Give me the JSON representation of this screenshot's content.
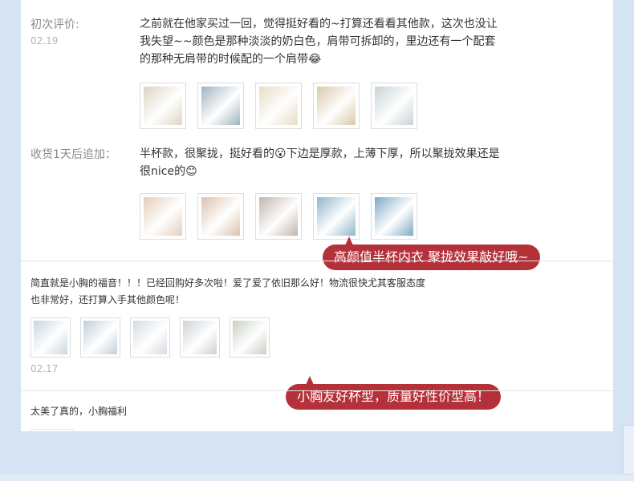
{
  "review1": {
    "label": "初次评价:",
    "date": "02.19",
    "lines": [
      "之前就在他家买过一回，觉得挺好看的~打算还看看其他款，这次也没让",
      "我失望~~颜色是那种淡淡的奶白色，肩带可拆卸的，里边还有一个配套",
      "的那种无肩带的时候配的一个肩带😂"
    ],
    "photo_colors": [
      "#ddd4c2",
      "#9fb2bf",
      "#e8dcc4",
      "#d9c9a8",
      "#c8d2d6"
    ]
  },
  "followup": {
    "label": "收货1天后追加：",
    "lines": [
      "半杯款，很聚拢，挺好看的😮下边是厚款，上薄下厚，所以聚拢效果还是",
      "很nice的😊"
    ],
    "photo_colors": [
      "#e4cdbb",
      "#dcc1ad",
      "#c3b4ad",
      "#8fb6c9",
      "#7eaac4"
    ]
  },
  "bubble1": "高颜值半杯内衣  聚拢效果敲好哦~",
  "review2": {
    "lines": [
      "简直就是小胸的福音！！！已经回购好多次啦！爱了爱了依旧那么好！物流很快尤其客服态度",
      "也非常好，还打算入手其他颜色呢！"
    ],
    "date": "02.17",
    "photo_colors": [
      "#c9d6df",
      "#c2cfd8",
      "#d5dbe1",
      "#cdd2d6",
      "#c8d0c4"
    ]
  },
  "bubble2": "小胸友好杯型，质量好性价型高！",
  "review3": {
    "text": "太美了真的，小胸福利"
  },
  "colors": {
    "accent": "#b5313a",
    "page_bg": "#d5e3f3"
  }
}
